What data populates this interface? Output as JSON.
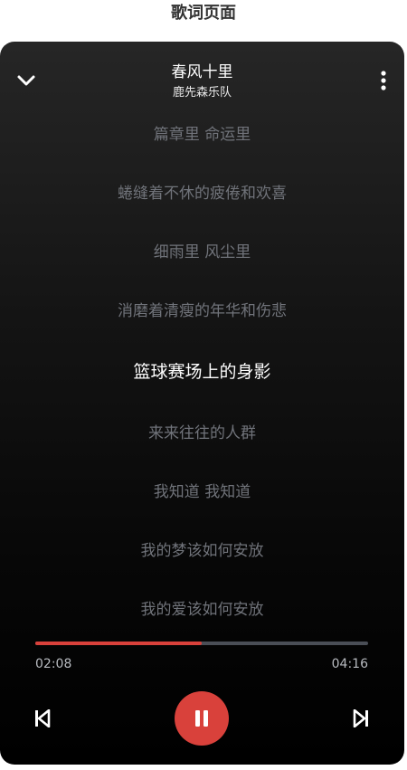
{
  "page": {
    "title": "歌词页面"
  },
  "player": {
    "song_title": "春风十里",
    "artist": "鹿先森乐队",
    "lyrics": [
      "篇章里 命运里",
      "蜷缝着不休的疲倦和欢喜",
      "细雨里 风尘里",
      "消磨着清瘦的年华和伤悲",
      "篮球赛场上的身影",
      "来来往往的人群",
      "我知道 我知道",
      "我的梦该如何安放",
      "我的爱该如何安放"
    ],
    "active_lyric_index": 4,
    "current_time": "02:08",
    "total_time": "04:16",
    "progress": 0.5
  },
  "icons": {
    "back": "chevron-down-icon",
    "more": "more-vertical-icon",
    "prev": "skip-previous-icon",
    "pause": "pause-icon",
    "next": "skip-next-icon"
  },
  "colors": {
    "accent": "#d9413b",
    "track": "#4a4e56",
    "lyric_inactive": "#70737a",
    "lyric_active": "#ffffff"
  }
}
